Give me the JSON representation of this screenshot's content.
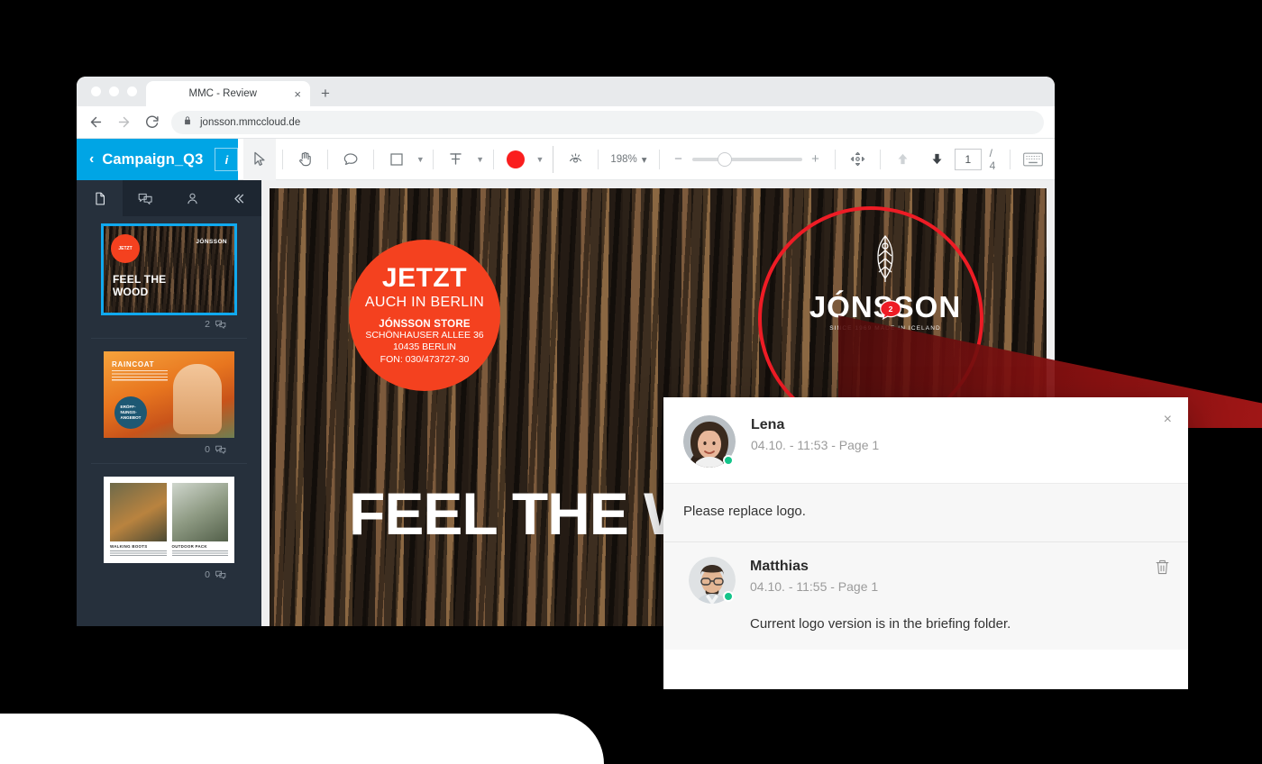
{
  "browser": {
    "tab_title": "MMC - Review",
    "tab_close": "×",
    "new_tab": "+",
    "url": "jonsson.mmccloud.de"
  },
  "app": {
    "back_chevron": "‹",
    "project_title": "Campaign_Q3",
    "info_label": "i",
    "accent_color": "#00a5e5"
  },
  "toolbar": {
    "zoom_level": "198%",
    "zoom_caret": "▾",
    "minus": "−",
    "plus": "+",
    "page_current": "1",
    "page_total": "/ 4",
    "annotation_color": "#fa1e1e",
    "tools": [
      {
        "name": "select-tool",
        "label": "Select"
      },
      {
        "name": "pan-tool",
        "label": "Pan"
      },
      {
        "name": "comment-tool",
        "label": "Comment"
      },
      {
        "name": "shape-tool",
        "label": "Rectangle"
      },
      {
        "name": "text-tool",
        "label": "Text"
      },
      {
        "name": "color-tool",
        "label": "Color"
      },
      {
        "name": "visibility-tool",
        "label": "Show / hide annotations"
      }
    ]
  },
  "sidebar": {
    "tabs": [
      {
        "name": "pages",
        "label": "Pages",
        "active": true
      },
      {
        "name": "comments",
        "label": "Comments",
        "active": false
      },
      {
        "name": "users",
        "label": "Users",
        "active": false
      },
      {
        "name": "collapse",
        "label": "Collapse",
        "active": false
      }
    ],
    "thumbnails": [
      {
        "page": "1",
        "comment_count": "2",
        "selected": true,
        "headline": "FEEL THE\nWOOD",
        "badge_text": "JETZT",
        "logo": "JÓNSSON"
      },
      {
        "page": "2",
        "comment_count": "0",
        "selected": false,
        "title": "RAINCOAT",
        "badge_text": "ERÖFF-\nNUNGS-\nANGEBOT"
      },
      {
        "page": "3",
        "comment_count": "0",
        "selected": false,
        "caption_left": "WALKING BOOTS",
        "caption_right": "OUTDOOR PACK"
      }
    ]
  },
  "artboard": {
    "stamp": {
      "line1": "JETZT",
      "line2": "AUCH IN BERLIN",
      "line3": "JÓNSSON STORE",
      "line4": "SCHÖNHAUSER ALLEE 36",
      "line5": "10435 BERLIN",
      "line6": "FON: 030/473727-30"
    },
    "logo": {
      "name": "JÓNSSON",
      "tagline": "SINCE 1969 MADE IN ICELAND"
    },
    "headline": "FEEL THE WOOD",
    "annotation": {
      "color": "#ee1c25",
      "badge_count": "2"
    }
  },
  "comments_panel": {
    "close_label": "×",
    "main": {
      "author": "Lena",
      "meta": "04.10. - 11:53 - Page 1",
      "text": "Please replace logo."
    },
    "reply": {
      "author": "Matthias",
      "meta": "04.10. - 11:55 - Page 1",
      "text": "Current logo version is in the briefing folder."
    }
  }
}
